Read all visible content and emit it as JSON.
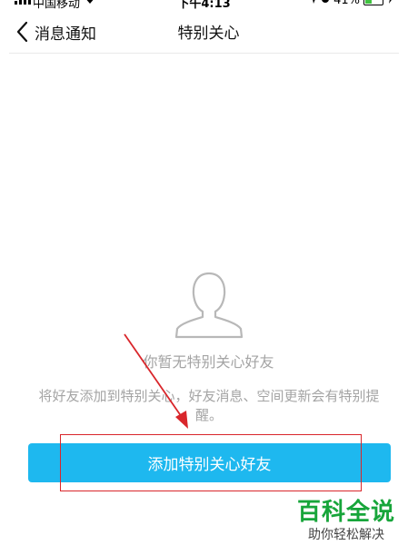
{
  "status_bar": {
    "carrier": "中国移动",
    "time": "下午4:13",
    "battery": "41%",
    "battery_level": 0.41
  },
  "nav": {
    "back_label": "消息通知",
    "title": "特别关心"
  },
  "empty_state": {
    "title": "你暂无特别关心好友",
    "description": "将好友添加到特别关心，好友消息、空间更新会有特别提醒。"
  },
  "actions": {
    "add_button_label": "添加特别关心好友"
  },
  "watermark": {
    "title": "百科全说",
    "subtitle": "助你轻松解决"
  },
  "colors": {
    "accent": "#1eb8ef",
    "annotation": "#d9262b",
    "muted_text": "#a4a4a4",
    "watermark_green": "#17a53a"
  }
}
